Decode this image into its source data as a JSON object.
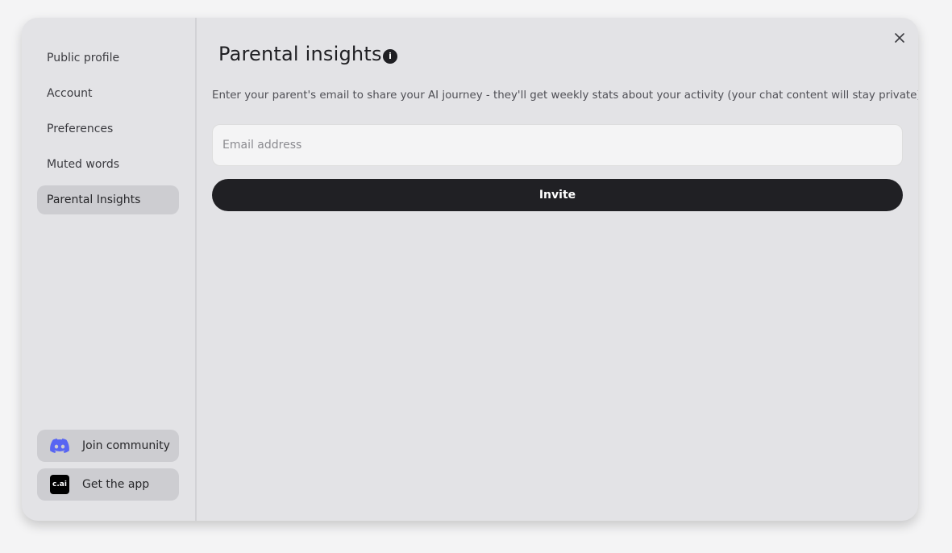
{
  "sidebar": {
    "items": [
      {
        "label": "Public profile",
        "active": false
      },
      {
        "label": "Account",
        "active": false
      },
      {
        "label": "Preferences",
        "active": false
      },
      {
        "label": "Muted words",
        "active": false
      },
      {
        "label": "Parental Insights",
        "active": true
      }
    ],
    "join_community_label": "Join community",
    "get_app_label": "Get the app",
    "app_icon_text": "c.ai",
    "discord_color": "#5865f2"
  },
  "main": {
    "title": "Parental insights",
    "info_icon_text": "i",
    "description": "Enter your parent's email to share your AI journey - they'll get weekly stats about your activity (your chat content will stay private)",
    "email_placeholder": "Email address",
    "email_value": "",
    "invite_label": "Invite"
  }
}
